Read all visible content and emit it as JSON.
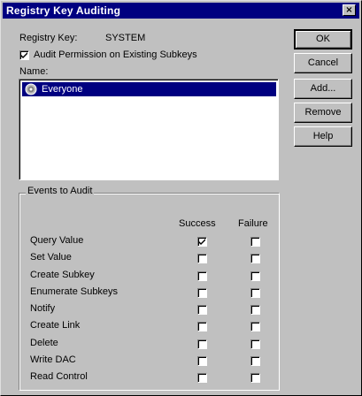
{
  "window": {
    "title": "Registry Key Auditing",
    "close_glyph": "×"
  },
  "registry_key": {
    "label": "Registry Key:",
    "value": "SYSTEM"
  },
  "audit_subkeys": {
    "label": "Audit Permission on Existing Subkeys",
    "checked": true
  },
  "name_label": "Name:",
  "names": [
    {
      "label": "Everyone",
      "icon": "group-icon",
      "selected": true
    }
  ],
  "events": {
    "legend": "Events to Audit",
    "success_header": "Success",
    "failure_header": "Failure",
    "rows": [
      {
        "label": "Query Value",
        "success": true,
        "failure": false
      },
      {
        "label": "Set Value",
        "success": false,
        "failure": false
      },
      {
        "label": "Create Subkey",
        "success": false,
        "failure": false
      },
      {
        "label": "Enumerate Subkeys",
        "success": false,
        "failure": false
      },
      {
        "label": "Notify",
        "success": false,
        "failure": false
      },
      {
        "label": "Create Link",
        "success": false,
        "failure": false
      },
      {
        "label": "Delete",
        "success": false,
        "failure": false
      },
      {
        "label": "Write DAC",
        "success": false,
        "failure": false
      },
      {
        "label": "Read Control",
        "success": false,
        "failure": false
      }
    ]
  },
  "buttons": {
    "ok": "OK",
    "cancel": "Cancel",
    "add": "Add...",
    "remove": "Remove",
    "help": "Help"
  },
  "colors": {
    "title_bar": "#000080",
    "face": "#c0c0c0",
    "selection": "#000080"
  }
}
